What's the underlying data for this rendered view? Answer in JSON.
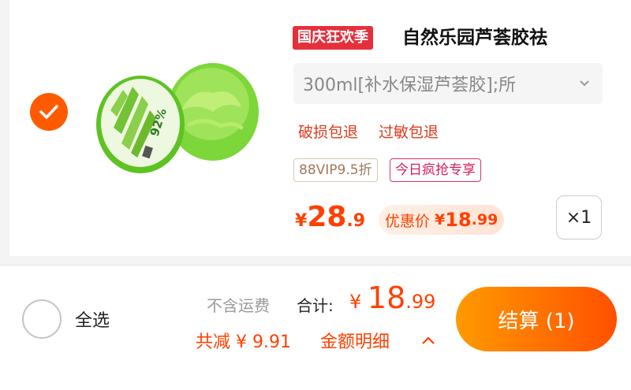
{
  "item": {
    "selected": true,
    "festival_tag": "国庆狂欢季",
    "title": "自然乐园芦荟胶祛",
    "spec": "300ml[补水保湿芦荟胶];所",
    "services": [
      "破损包退",
      "过敏包退"
    ],
    "badges": {
      "vip": "88VIP9.5折",
      "today": "今日疯抢专享"
    },
    "price": {
      "symbol": "¥",
      "integer": "28",
      "decimal": ".9"
    },
    "promo": {
      "label": "优惠价",
      "symbol": "¥",
      "integer": "18",
      "decimal": ".99"
    },
    "quantity": "×1",
    "image_text": "92%"
  },
  "footer": {
    "select_all_label": "全选",
    "freight_note": "不含运费",
    "total_label": "合计:",
    "total": {
      "symbol": "¥ ",
      "integer": "18",
      "decimal": ".99"
    },
    "saved": "共减 ¥ 9.91",
    "detail": "金额明细",
    "checkout_label": "结算 (1)"
  },
  "colors": {
    "accent": "#ff5a00",
    "price": "#ff4000",
    "festival": "#e5303c",
    "today_badge": "#d81e5b"
  }
}
